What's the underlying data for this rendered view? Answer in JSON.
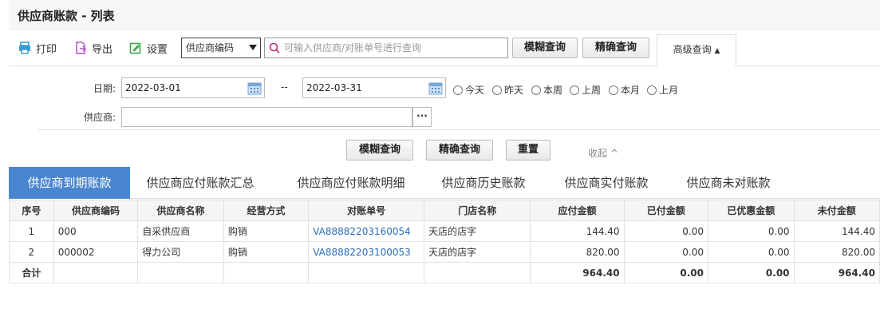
{
  "page_title": "供应商账款 - 列表",
  "toolbar": {
    "print_label": "打印",
    "export_label": "导出",
    "settings_label": "设置",
    "field_select": "供应商编码",
    "search_placeholder": "可输入供应商/对账单号进行查询",
    "fuzzy_label": "模糊查询",
    "exact_label": "精确查询",
    "advanced_label": "高级查询"
  },
  "filters": {
    "date_label": "日期:",
    "date_from": "2022-03-01",
    "date_sep": "--",
    "date_to": "2022-03-31",
    "ranges": [
      "今天",
      "昨天",
      "本周",
      "上周",
      "本月",
      "上月"
    ],
    "supplier_label": "供应商:",
    "supplier_value": "",
    "more_label": "···",
    "fuzzy_label": "模糊查询",
    "exact_label": "精确查询",
    "reset_label": "重置",
    "collapse_label": "收起 ^"
  },
  "tabs": [
    "供应商到期账款",
    "供应商应付账款汇总",
    "供应商应付账款明细",
    "供应商历史账款",
    "供应商实付账款",
    "供应商未对账款"
  ],
  "active_tab": 0,
  "table": {
    "columns": [
      "序号",
      "供应商编码",
      "供应商名称",
      "经营方式",
      "对账单号",
      "门店名称",
      "应付金额",
      "已付金额",
      "已优惠金额",
      "未付金额"
    ],
    "rows": [
      [
        "1",
        "000",
        "自采供应商",
        "购销",
        "VA88882203160054",
        "天店的店字",
        "144.40",
        "0.00",
        "0.00",
        "144.40"
      ],
      [
        "2",
        "000002",
        "得力公司",
        "购销",
        "VA88882203100053",
        "天店的店字",
        "820.00",
        "0.00",
        "0.00",
        "820.00"
      ]
    ],
    "total": [
      "合计",
      "",
      "",
      "",
      "",
      "",
      "964.40",
      "0.00",
      "0.00",
      "964.40"
    ]
  },
  "colors": {
    "accent": "#4a86cf",
    "link": "#2a6eb5",
    "print_icon": "#3a9bd5",
    "export_icon": "#b455c8",
    "settings_icon": "#3aa845",
    "search_icon": "#c0307a"
  }
}
